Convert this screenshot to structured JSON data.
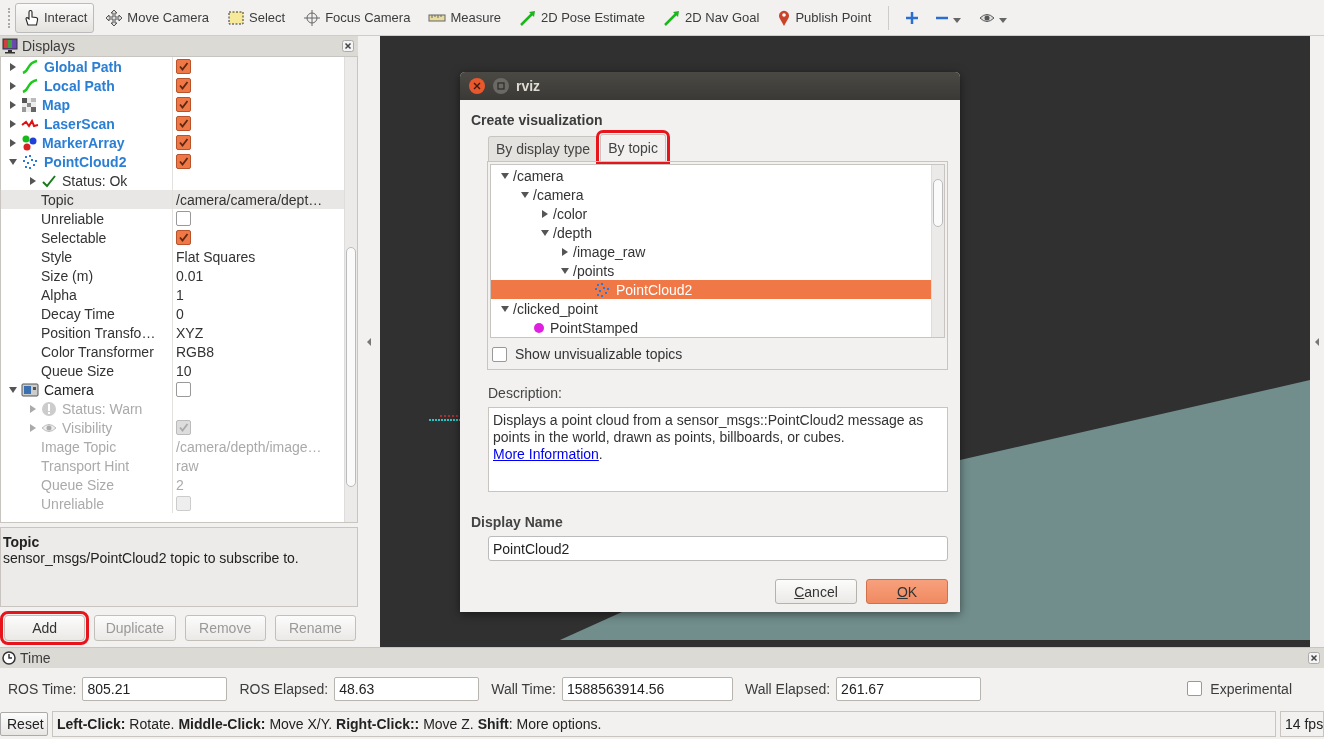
{
  "toolbar": {
    "tools": [
      {
        "label": "Interact",
        "selected": true
      },
      {
        "label": "Move Camera",
        "selected": false
      },
      {
        "label": "Select",
        "selected": false
      },
      {
        "label": "Focus Camera",
        "selected": false
      },
      {
        "label": "Measure",
        "selected": false
      },
      {
        "label": "2D Pose Estimate",
        "selected": false
      },
      {
        "label": "2D Nav Goal",
        "selected": false
      },
      {
        "label": "Publish Point",
        "selected": false
      }
    ]
  },
  "displays": {
    "title": "Displays",
    "tree": [
      {
        "kind": "path",
        "name": "Global Path",
        "checked": true,
        "expanded": false,
        "selected": false
      },
      {
        "kind": "path",
        "name": "Local Path",
        "checked": true,
        "expanded": false,
        "selected": false
      },
      {
        "kind": "map",
        "name": "Map",
        "checked": true,
        "expanded": false,
        "selected": false
      },
      {
        "kind": "laserscan",
        "name": "LaserScan",
        "checked": true,
        "expanded": false,
        "selected": false
      },
      {
        "kind": "markers",
        "name": "MarkerArray",
        "checked": true,
        "expanded": false,
        "selected": false
      },
      {
        "kind": "pointcloud",
        "name": "PointCloud2",
        "checked": true,
        "expanded": true,
        "selected": false,
        "children": [
          {
            "kind": "status_ok",
            "name": "Status: Ok",
            "expanded": false,
            "disabled": false,
            "selected": false
          },
          {
            "kind": "property",
            "name": "Topic",
            "value": "/camera/camera/dept…",
            "disabled": false,
            "selected": true
          },
          {
            "kind": "property",
            "name": "Unreliable",
            "checked": false,
            "disabled": false,
            "selected": false
          },
          {
            "kind": "property",
            "name": "Selectable",
            "checked": true,
            "disabled": false,
            "selected": false
          },
          {
            "kind": "property",
            "name": "Style",
            "value": "Flat Squares",
            "disabled": false,
            "selected": false
          },
          {
            "kind": "property",
            "name": "Size (m)",
            "value": "0.01",
            "disabled": false,
            "selected": false
          },
          {
            "kind": "property",
            "name": "Alpha",
            "value": "1",
            "disabled": false,
            "selected": false
          },
          {
            "kind": "property",
            "name": "Decay Time",
            "value": "0",
            "disabled": false,
            "selected": false
          },
          {
            "kind": "property",
            "name": "Position Transfo…",
            "value": "XYZ",
            "disabled": false,
            "selected": false
          },
          {
            "kind": "property",
            "name": "Color Transformer",
            "value": "RGB8",
            "disabled": false,
            "selected": false
          },
          {
            "kind": "property",
            "name": "Queue Size",
            "value": "10",
            "disabled": false,
            "selected": false
          }
        ]
      },
      {
        "kind": "camera",
        "name": "Camera",
        "checked": false,
        "expanded": true,
        "selected": false,
        "children": [
          {
            "kind": "status_warn",
            "name": "Status: Warn",
            "expanded": false,
            "disabled": true,
            "selected": false
          },
          {
            "kind": "visibility",
            "name": "Visibility",
            "expanded": false,
            "checked": true,
            "disabled": true,
            "selected": false
          },
          {
            "kind": "property",
            "name": "Image Topic",
            "value": "/camera/depth/image…",
            "disabled": true,
            "selected": false
          },
          {
            "kind": "property",
            "name": "Transport Hint",
            "value": "raw",
            "disabled": true,
            "selected": false
          },
          {
            "kind": "property",
            "name": "Queue Size",
            "value": "2",
            "disabled": true,
            "selected": false
          },
          {
            "kind": "property",
            "name": "Unreliable",
            "checked": false,
            "disabled": true,
            "selected": false
          }
        ]
      }
    ],
    "help": {
      "title": "Topic",
      "text": "sensor_msgs/PointCloud2 topic to subscribe to."
    },
    "buttons": [
      {
        "label": "Add",
        "disabled": false,
        "annotated": true
      },
      {
        "label": "Duplicate",
        "disabled": true,
        "annotated": false
      },
      {
        "label": "Remove",
        "disabled": true,
        "annotated": false
      },
      {
        "label": "Rename",
        "disabled": true,
        "annotated": false
      }
    ]
  },
  "dialog": {
    "title": "rviz",
    "heading": "Create visualization",
    "tabs": [
      {
        "label": "By display type",
        "selected": false,
        "annotated": false
      },
      {
        "label": "By topic",
        "selected": true,
        "annotated": true
      }
    ],
    "topics": [
      {
        "name": "/camera",
        "expanded": true,
        "selected": false,
        "children": [
          {
            "name": "/camera",
            "expanded": true,
            "selected": false,
            "children": [
              {
                "name": "/color",
                "expanded": false,
                "selected": false
              },
              {
                "name": "/depth",
                "expanded": true,
                "selected": false,
                "children": [
                  {
                    "name": "/image_raw",
                    "expanded": false,
                    "selected": false
                  },
                  {
                    "name": "/points",
                    "expanded": true,
                    "selected": false,
                    "children": [
                      {
                        "kind": "pointcloud",
                        "name": "PointCloud2",
                        "selected": true
                      }
                    ]
                  }
                ]
              }
            ]
          }
        ]
      },
      {
        "name": "/clicked_point",
        "expanded": true,
        "selected": false,
        "children": [
          {
            "kind": "point",
            "name": "PointStamped",
            "selected": false
          }
        ]
      }
    ],
    "show_unvisualizable": {
      "label": "Show unvisualizable topics",
      "checked": false
    },
    "description_label": "Description:",
    "description": {
      "text": "Displays a point cloud from a sensor_msgs::PointCloud2 message as points in the world, drawn as points, billboards, or cubes. ",
      "link": "More Information",
      "after": "."
    },
    "name_label": "Display Name",
    "name_value": "PointCloud2",
    "buttons": [
      {
        "label": "Cancel",
        "default": false
      },
      {
        "label": "OK",
        "default": true
      }
    ]
  },
  "time": {
    "title": "Time",
    "fields": [
      {
        "label": "ROS Time:",
        "value": "805.21"
      },
      {
        "label": "ROS Elapsed:",
        "value": "48.63"
      },
      {
        "label": "Wall Time:",
        "value": "1588563914.56"
      },
      {
        "label": "Wall Elapsed:",
        "value": "261.67"
      }
    ],
    "experimental": {
      "label": "Experimental",
      "checked": false
    }
  },
  "status_bar": {
    "reset": "Reset",
    "hint": "**Left-Click:** Rotate. **Middle-Click:** Move X/Y. **Right-Click::** Move Z. **Shift**: More options.",
    "fps": "14 fps"
  }
}
